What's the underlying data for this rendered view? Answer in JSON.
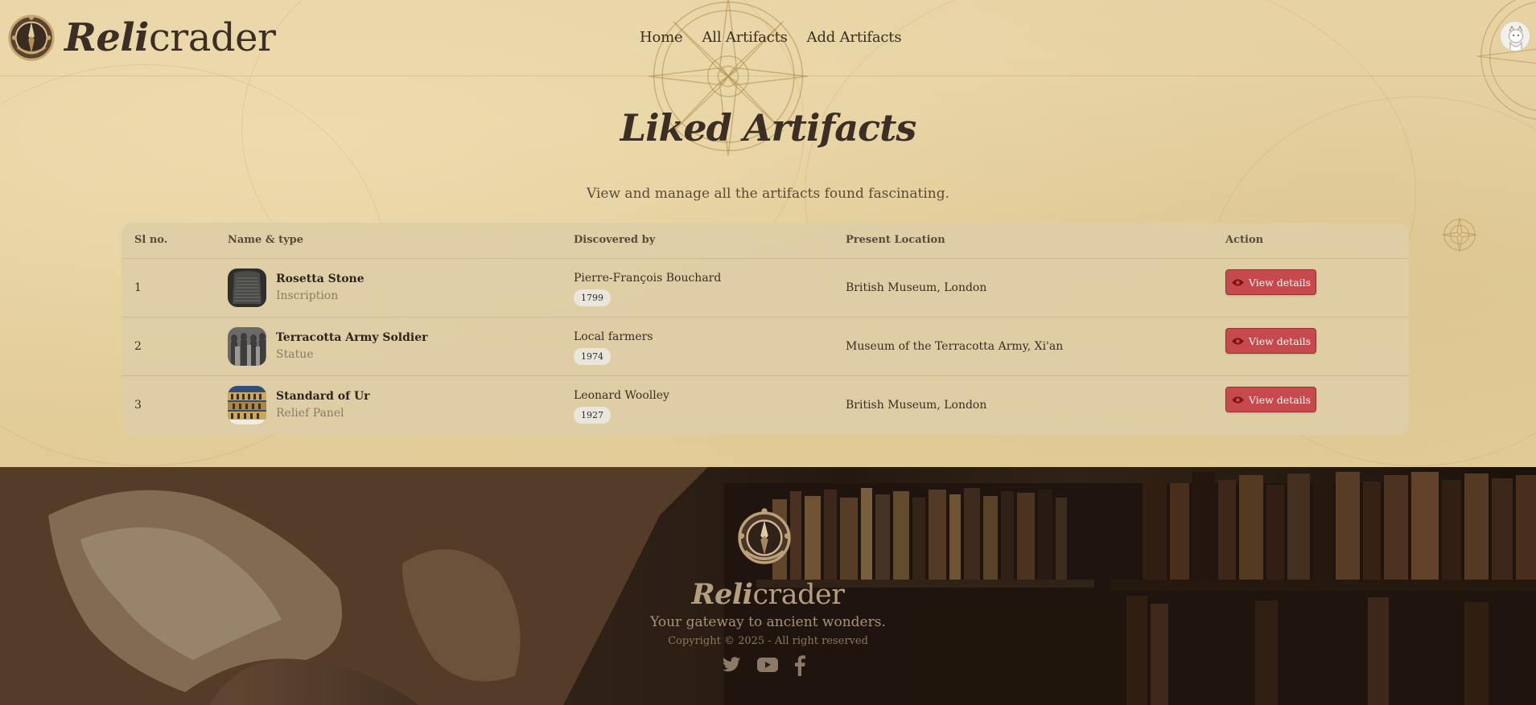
{
  "brand": {
    "part1": "Reli",
    "part2": "crader"
  },
  "nav": {
    "home": "Home",
    "all": "All Artifacts",
    "add": "Add Artifacts"
  },
  "page": {
    "title": "Liked Artifacts",
    "subtitle": "View and manage all the artifacts found fascinating."
  },
  "table": {
    "headers": {
      "sl": "Sl no.",
      "name": "Name & type",
      "discovered": "Discovered by",
      "location": "Present Location",
      "action": "Action"
    },
    "rows": [
      {
        "sl": "1",
        "name": "Rosetta Stone",
        "type": "Inscription",
        "discovered_by": "Pierre-François Bouchard",
        "year": "1799",
        "location": "British Museum, London",
        "action": "View details"
      },
      {
        "sl": "2",
        "name": "Terracotta Army Soldier",
        "type": "Statue",
        "discovered_by": "Local farmers",
        "year": "1974",
        "location": "Museum of the Terracotta Army, Xi'an",
        "action": "View details"
      },
      {
        "sl": "3",
        "name": "Standard of Ur",
        "type": "Relief Panel",
        "discovered_by": "Leonard Woolley",
        "year": "1927",
        "location": "British Museum, London",
        "action": "View details"
      }
    ]
  },
  "footer": {
    "brand1": "Reli",
    "brand2": "crader",
    "tagline": "Your gateway to ancient wonders.",
    "copyright": "Copyright © 2025 - All right reserved",
    "social": [
      "twitter-icon",
      "youtube-icon",
      "facebook-icon"
    ]
  },
  "colors": {
    "parchment": "#e4cf9d",
    "button": "#c64a4d",
    "text": "#3a2e22"
  }
}
